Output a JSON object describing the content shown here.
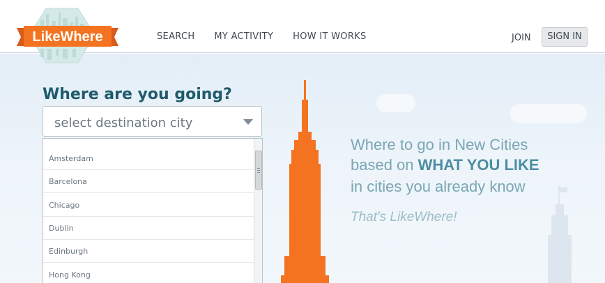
{
  "brand": {
    "logo_text": "LikeWhere"
  },
  "nav": {
    "items": [
      {
        "label": "SEARCH"
      },
      {
        "label": "MY ACTIVITY"
      },
      {
        "label": "HOW IT WORKS"
      }
    ],
    "join_label": "JOIN",
    "signin_label": "SIGN IN"
  },
  "search": {
    "question": "Where are you going?",
    "placeholder": "select destination city",
    "cities": [
      "Amsterdam",
      "Barcelona",
      "Chicago",
      "Dublin",
      "Edinburgh",
      "Hong Kong"
    ]
  },
  "hero": {
    "line1": "Where to go in New Cities",
    "line2_prefix": "based on ",
    "line2_emph": "WHAT YOU LIKE",
    "line3": "in cities you already know",
    "slogan": "That's LikeWhere!"
  },
  "colors": {
    "brand_orange": "#f47321",
    "heading_teal": "#1f5b6b",
    "tagline_blue": "#7aa6b3"
  }
}
